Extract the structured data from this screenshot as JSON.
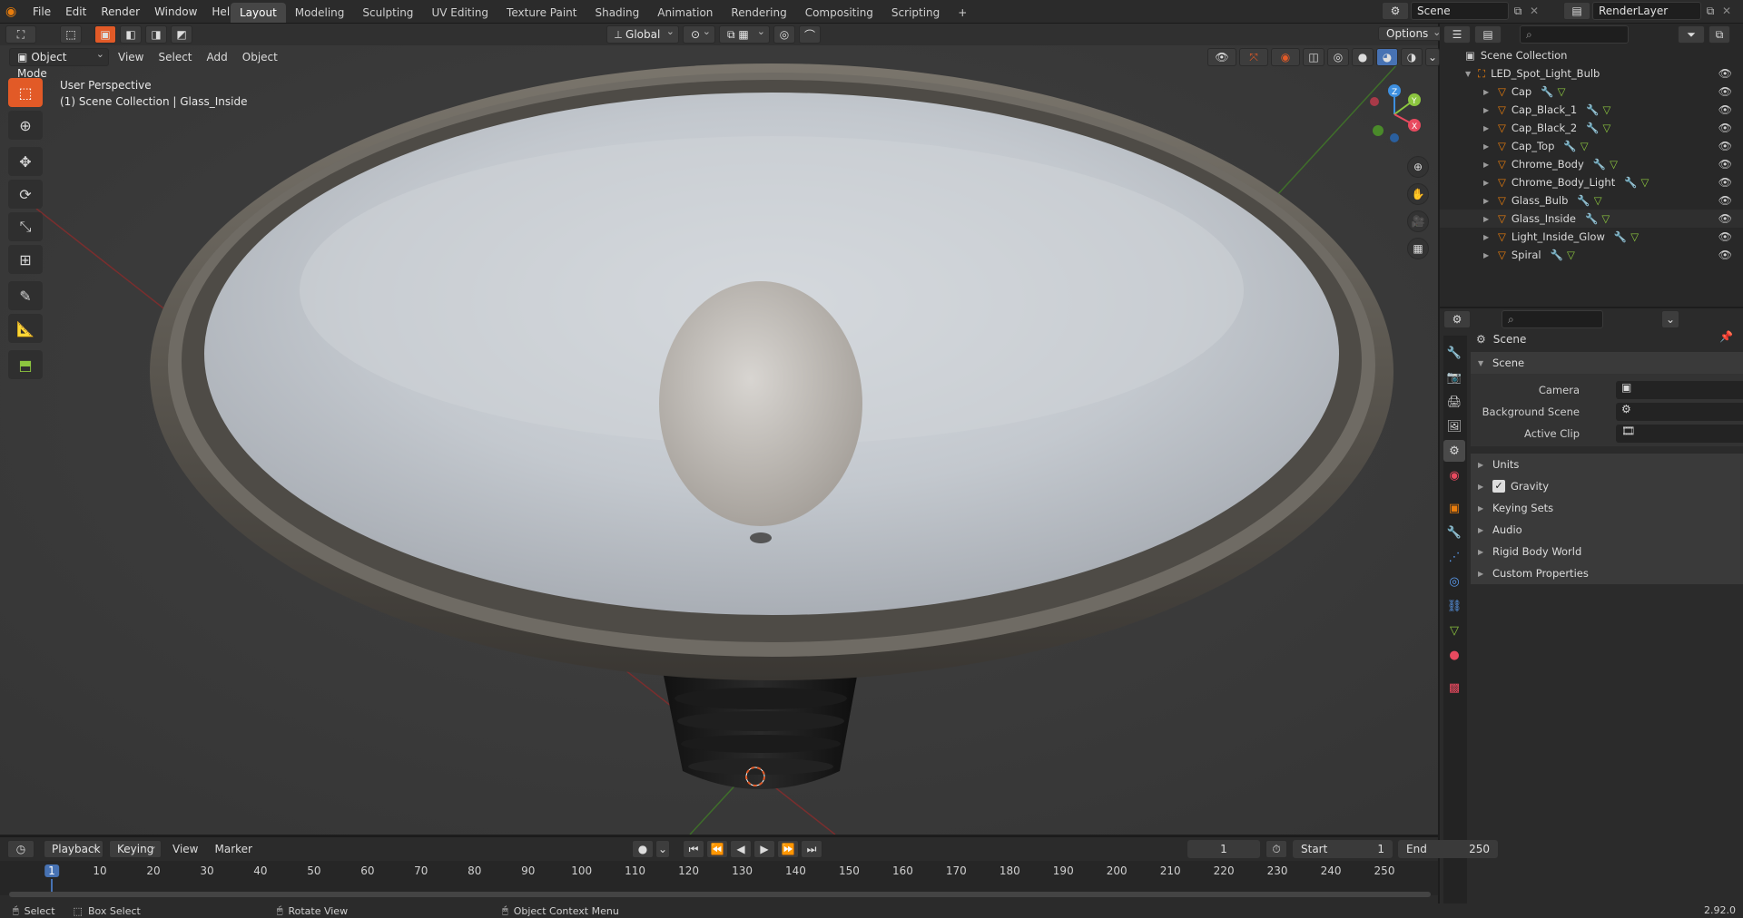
{
  "topbar": {
    "menus": [
      "File",
      "Edit",
      "Render",
      "Window",
      "Help"
    ],
    "workspaces": [
      "Layout",
      "Modeling",
      "Sculpting",
      "UV Editing",
      "Texture Paint",
      "Shading",
      "Animation",
      "Rendering",
      "Compositing",
      "Scripting"
    ],
    "active_workspace": "Layout",
    "add_tab": "+",
    "scene_name": "Scene",
    "view_layer": "RenderLayer"
  },
  "viewport_header": {
    "mode": "Object Mode",
    "menus": [
      "View",
      "Select",
      "Add",
      "Object"
    ],
    "transform_orientation": "Global",
    "options_label": "Options"
  },
  "viewport": {
    "perspective_label": "User Perspective",
    "context_label": "(1) Scene Collection | Glass_Inside",
    "gizmo_axes": [
      "X",
      "Y",
      "Z"
    ]
  },
  "outliner": {
    "root": "Scene Collection",
    "collection": "LED_Spot_Light_Bulb",
    "objects": [
      "Cap",
      "Cap_Black_1",
      "Cap_Black_2",
      "Cap_Top",
      "Chrome_Body",
      "Chrome_Body_Light",
      "Glass_Bulb",
      "Glass_Inside",
      "Light_Inside_Glow",
      "Spiral"
    ],
    "selected_object": "Glass_Inside"
  },
  "properties": {
    "context_title": "Scene",
    "panel_title": "Scene",
    "fields": [
      {
        "label": "Camera"
      },
      {
        "label": "Background Scene"
      },
      {
        "label": "Active Clip"
      }
    ],
    "subpanels": [
      "Units",
      "Gravity",
      "Keying Sets",
      "Audio",
      "Rigid Body World",
      "Custom Properties"
    ],
    "gravity_checked": true
  },
  "timeline": {
    "menus": [
      "Playback",
      "Keying",
      "View",
      "Marker"
    ],
    "current_frame": "1",
    "start_label": "Start",
    "start_value": "1",
    "end_label": "End",
    "end_value": "250",
    "ticks": [
      "1",
      "10",
      "20",
      "30",
      "40",
      "50",
      "60",
      "70",
      "80",
      "90",
      "100",
      "110",
      "120",
      "130",
      "140",
      "150",
      "160",
      "170",
      "180",
      "190",
      "200",
      "210",
      "220",
      "230",
      "240",
      "250"
    ]
  },
  "statusbar": {
    "items": [
      "Select",
      "Box Select",
      "Rotate View",
      "Object Context Menu"
    ],
    "version": "2.92.0"
  },
  "colors": {
    "accent": "#e25a27",
    "selection_blue": "#4772b3",
    "x_axis": "#e84a5f",
    "y_axis": "#8cc63f",
    "z_axis": "#3d8fe0"
  }
}
